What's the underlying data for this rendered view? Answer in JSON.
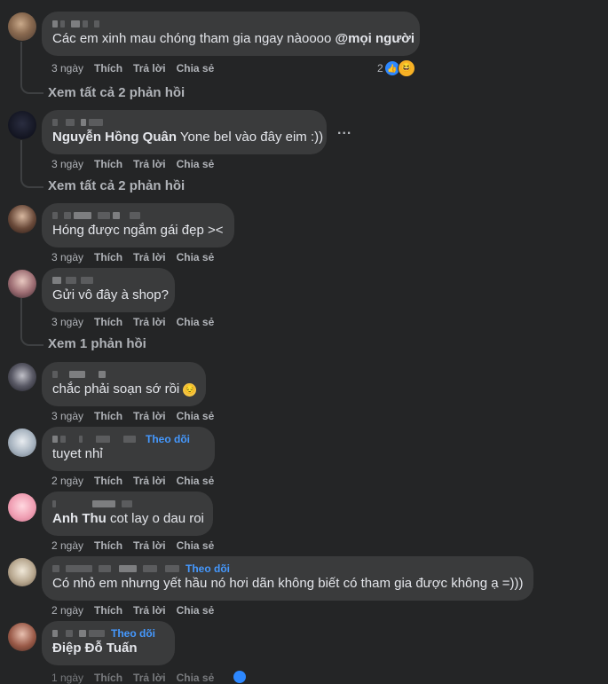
{
  "labels": {
    "like": "Thích",
    "reply": "Trả lời",
    "share": "Chia sẻ",
    "follow": "Theo dõi"
  },
  "comments": [
    {
      "author": "",
      "text": "Các em xinh mau chóng tham gia ngay nàoooo ",
      "mention": "@mọi người",
      "time": "3 ngày",
      "reaction_count": "2",
      "replies": "Xem tất cả 2 phản hồi"
    },
    {
      "author_tag": "Nguyễn Hồng Quân",
      "text": " Yone bel vào đây eim :))",
      "time": "3 ngày",
      "replies": "Xem tất cả 2 phản hồi",
      "more": "..."
    },
    {
      "text": "Hóng được ngắm gái đẹp ><",
      "time": "3 ngày"
    },
    {
      "text": "Gửi vô đây à shop?",
      "time": "3 ngày",
      "replies": "Xem 1 phản hồi"
    },
    {
      "text": "chắc phải soạn sớ rồi",
      "time": "3 ngày",
      "emoji": "😔"
    },
    {
      "text": "tuyet nhỉ",
      "time": "2 ngày"
    },
    {
      "author_tag": "Anh Thu",
      "text": " cot lay o dau roi",
      "time": "2 ngày"
    },
    {
      "text": "Có nhỏ em nhưng yết hầu nó hơi dãn không biết có tham gia được không ạ =)))",
      "time": "2 ngày"
    },
    {
      "author_tag": "Điệp Đỗ Tuấn",
      "text": "",
      "time": "1 ngày"
    }
  ],
  "colors": {
    "background": "#242526",
    "bubble": "#3a3b3c",
    "link": "#4599ff",
    "muted": "#b0b3b8"
  }
}
